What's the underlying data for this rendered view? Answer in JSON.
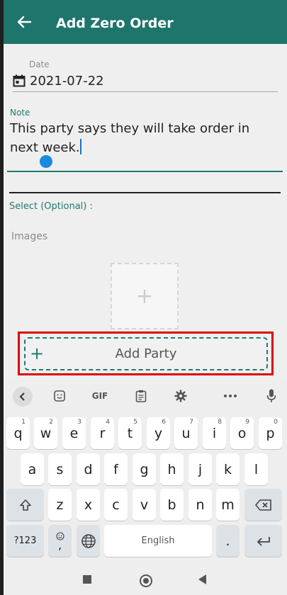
{
  "app": {
    "title": "Add Zero Order",
    "colors": {
      "primary": "#1e756b",
      "accent": "#1e7a70",
      "highlight": "#e00000"
    }
  },
  "form": {
    "date_label": "Date",
    "date_value": "2021-07-22",
    "note_label": "Note",
    "note_value": "This party says they will take order in next week.",
    "select_label": "Select (Optional) :",
    "images_label": "Images",
    "add_image_icon": "plus-icon",
    "add_party_label": "Add Party"
  },
  "keyboard": {
    "toolbar": {
      "back_icon": "chevron-left-icon",
      "items": [
        "sticker-icon",
        "GIF",
        "clipboard-icon",
        "gear-icon",
        "more-icon",
        "mic-icon"
      ],
      "gif_label": "GIF"
    },
    "row1": [
      {
        "key": "q",
        "hint": "1"
      },
      {
        "key": "w",
        "hint": "2"
      },
      {
        "key": "e",
        "hint": "3"
      },
      {
        "key": "r",
        "hint": "4"
      },
      {
        "key": "t",
        "hint": "5"
      },
      {
        "key": "y",
        "hint": "6"
      },
      {
        "key": "u",
        "hint": "7"
      },
      {
        "key": "i",
        "hint": "8"
      },
      {
        "key": "o",
        "hint": "9"
      },
      {
        "key": "p",
        "hint": "0"
      }
    ],
    "row2": [
      "a",
      "s",
      "d",
      "f",
      "g",
      "h",
      "j",
      "k",
      "l"
    ],
    "row3": [
      "z",
      "x",
      "c",
      "v",
      "b",
      "n",
      "m"
    ],
    "symbols_label": "?123",
    "comma_label": ",",
    "space_label": "English",
    "period_label": "."
  }
}
